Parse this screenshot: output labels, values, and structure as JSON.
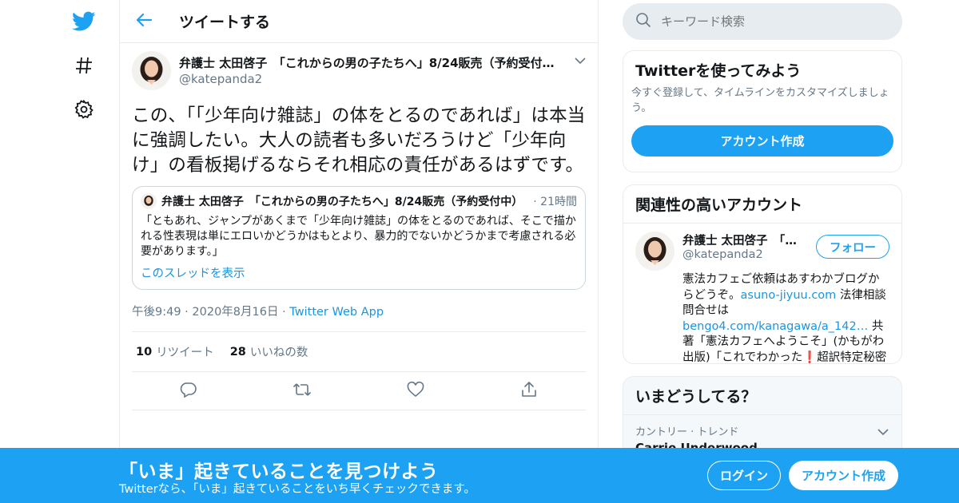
{
  "nav": {
    "icons": [
      "twitter-bird-icon",
      "hashtag-icon",
      "gear-icon"
    ]
  },
  "header": {
    "title": "ツイートする",
    "back_icon": "arrow-left-icon"
  },
  "tweet": {
    "author_name": "弁護士 太田啓子　「これからの男の子たちへ」8/24販売（予約受付…",
    "author_handle": "@katepanda2",
    "text": "この、「「少年向け雑誌」の体をとるのであれば」は本当に強調したい。大人の読者も多いだろうけど「少年向け」の看板掲げるならそれ相応の責任があるはずです。",
    "quote": {
      "author_name": "弁護士 太田啓子　「これからの男の子たちへ」8/24販売（予約受付中）",
      "time": "· 21時間",
      "text": "「ともあれ、ジャンプがあくまで「少年向け雑誌」の体をとるのであれば、そこで描かれる性表現は単にエロいかどうかはもとより、暴力的でないかどうかまで考慮される必要があります。」",
      "thread_link": "このスレッドを表示"
    },
    "time": "午後9:49",
    "date": "2020年8月16日",
    "source": "Twitter Web App",
    "retweet_count": "10",
    "retweet_label": "リツイート",
    "like_count": "28",
    "like_label": "いいねの数",
    "action_icons": [
      "reply-icon",
      "retweet-icon",
      "like-icon",
      "share-icon"
    ]
  },
  "sidebar": {
    "search_placeholder": "キーワード検索",
    "signup": {
      "title": "Twitterを使ってみよう",
      "desc": "今すぐ登録して、タイムラインをカスタマイズしましょう。",
      "button": "アカウント作成"
    },
    "related": {
      "title": "関連性の高いアカウント",
      "name": "弁護士 太田啓子　「これからの男の子たちへ」",
      "handle": "@katepanda2",
      "follow_button": "フォロー",
      "bio_1": "憲法カフェご依頼はあすわかブログからどうぞ。",
      "bio_link_1": "asuno-jiyuu.com",
      "bio_2": " 法律相談問合せは",
      "bio_link_2": "bengo4.com/kanagawa/a_142…",
      "bio_3": " 共著「憲法カフェへようこそ」(かもがわ出版)「これでわかった",
      "bio_emoji": "❗",
      "bio_4": "超訳特定秘密保護法」(岩波書店)。"
    },
    "trends": {
      "title": "いまどうしてる？",
      "meta": "カントリー · トレンド",
      "name": "Carrie Underwood"
    }
  },
  "banner": {
    "title": "「いま」起きていることを見つけよう",
    "subtitle": "Twitterなら、「いま」起きていることをいち早くチェックできます。",
    "login": "ログイン",
    "signup": "アカウント作成"
  },
  "colors": {
    "brand": "#1da1f2",
    "link": "#1b95e0",
    "muted": "#657786",
    "border": "#e6ecf0"
  }
}
